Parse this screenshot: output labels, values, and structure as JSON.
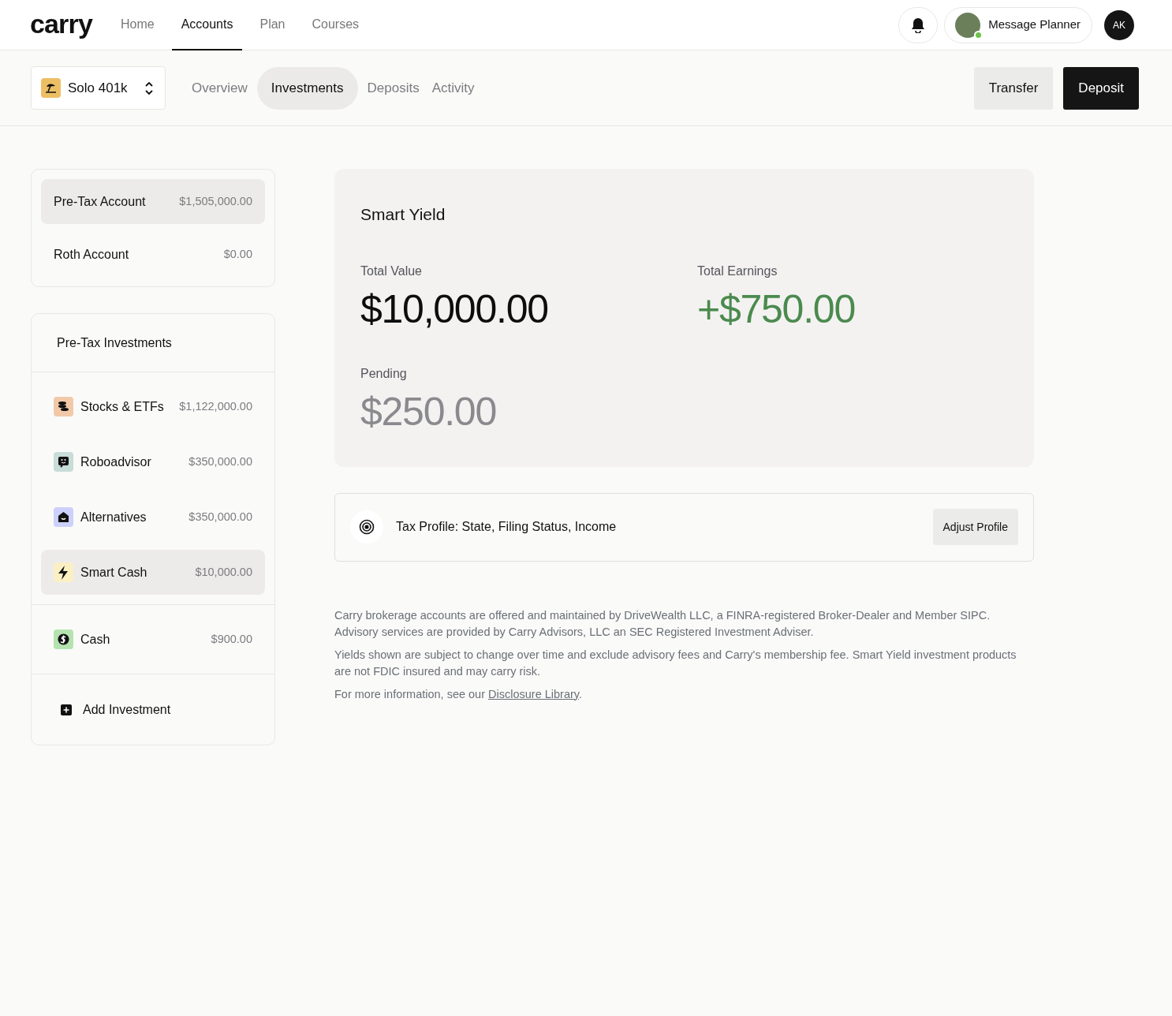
{
  "header": {
    "logo": "carry",
    "nav": [
      {
        "label": "Home",
        "selected": false
      },
      {
        "label": "Accounts",
        "selected": true
      },
      {
        "label": "Plan",
        "selected": false
      },
      {
        "label": "Courses",
        "selected": false
      }
    ],
    "message_button": "Message Planner",
    "planner_online": true,
    "user_initials": "AK"
  },
  "subheader": {
    "account": "Solo 401k",
    "tabs": [
      {
        "label": "Overview",
        "selected": false
      },
      {
        "label": "Investments",
        "selected": true
      },
      {
        "label": "Deposits",
        "selected": false
      },
      {
        "label": "Activity",
        "selected": false
      }
    ],
    "buttons": [
      {
        "label": "Transfer",
        "kind": "secondary"
      },
      {
        "label": "Deposit",
        "kind": "primary"
      }
    ]
  },
  "accounts": [
    {
      "name": "Pre-Tax Account",
      "amount": "$1,505,000.00",
      "selected": true
    },
    {
      "name": "Roth Account",
      "amount": "$0.00",
      "selected": false
    }
  ],
  "investments": {
    "title": "Pre-Tax Investments",
    "groups": [
      [
        {
          "name": "Stocks & ETFs",
          "amount": "$1,122,000.00",
          "kind": "stocks",
          "color": "#f2c9a8",
          "selected": false
        },
        {
          "name": "Roboadvisor",
          "amount": "$350,000.00",
          "kind": "robo",
          "color": "#c8dcd8",
          "selected": false
        },
        {
          "name": "Alternatives",
          "amount": "$350,000.00",
          "kind": "alt",
          "color": "#cdd0fa",
          "selected": false
        },
        {
          "name": "Smart Cash",
          "amount": "$10,000.00",
          "kind": "bolt",
          "color": "#fbefc4",
          "selected": true
        }
      ],
      [
        {
          "name": "Cash",
          "amount": "$900.00",
          "kind": "dollar",
          "color": "#b5e3b0",
          "selected": false
        }
      ]
    ],
    "add": "Add Investment"
  },
  "summary": {
    "title": "Smart Yield",
    "stats": [
      {
        "label": "Total Value",
        "value": "$10,000.00",
        "kind": "value"
      },
      {
        "label": "Total Earnings",
        "value": "+$750.00",
        "kind": "gain"
      },
      {
        "label": "Pending",
        "value": "$250.00",
        "kind": "pending"
      }
    ]
  },
  "tax_profile": {
    "text": "Tax Profile: State, Filing Status, Income",
    "button": "Adjust Profile"
  },
  "disclosures": [
    "Carry brokerage accounts are offered and maintained by DriveWealth LLC, a FINRA-registered Broker-Dealer and Member SIPC. Advisory services are provided by Carry Advisors, LLC an SEC Registered Investment Adviser.",
    "Yields shown are subject to change over time and exclude advisory fees and Carry's membership fee. Smart Yield investment products are not FDIC insured and may carry risk."
  ],
  "disclosure_link": {
    "before": "For more information, see our ",
    "link": "Disclosure Library",
    "after": "."
  }
}
